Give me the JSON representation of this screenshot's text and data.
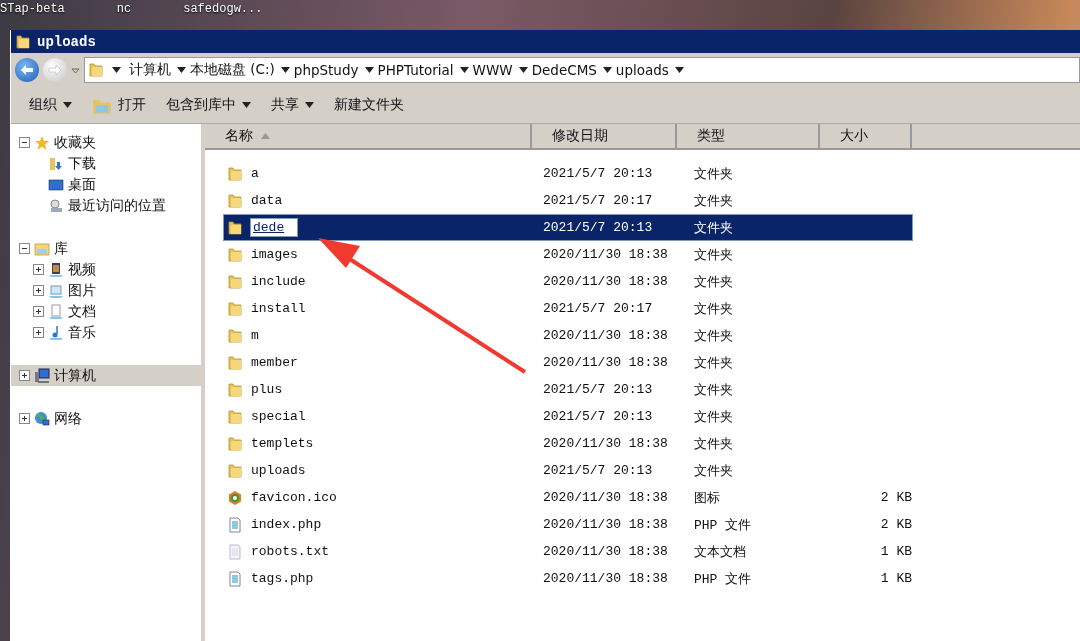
{
  "desktop_icons": [
    "STap-beta",
    "nc",
    "safedogw..."
  ],
  "window": {
    "title": "uploads"
  },
  "address_bar": {
    "crumbs": [
      "计算机",
      "本地磁盘 (C:)",
      "phpStudy",
      "PHPTutorial",
      "WWW",
      "DedeCMS",
      "uploads"
    ]
  },
  "toolbar": [
    {
      "label": "组织",
      "dropdown": true,
      "kind": "menu"
    },
    {
      "label": "打开",
      "dropdown": false,
      "kind": "open"
    },
    {
      "label": "包含到库中",
      "dropdown": true,
      "kind": "menu"
    },
    {
      "label": "共享",
      "dropdown": true,
      "kind": "menu"
    },
    {
      "label": "新建文件夹",
      "dropdown": false,
      "kind": "menu"
    }
  ],
  "sidebar": {
    "groups": [
      {
        "label": "收藏夹",
        "expanded": true,
        "selected": false,
        "children": [
          {
            "label": "下载",
            "selected": false
          },
          {
            "label": "桌面",
            "selected": false
          },
          {
            "label": "最近访问的位置",
            "selected": false
          }
        ]
      },
      {
        "label": "库",
        "expanded": true,
        "selected": false,
        "children": [
          {
            "label": "视频",
            "selected": false,
            "expanded": false
          },
          {
            "label": "图片",
            "selected": false,
            "expanded": false
          },
          {
            "label": "文档",
            "selected": false,
            "expanded": false
          },
          {
            "label": "音乐",
            "selected": false,
            "expanded": false
          }
        ]
      },
      {
        "label": "计算机",
        "expanded": false,
        "selected": true
      },
      {
        "label": "网络",
        "expanded": false,
        "selected": false
      }
    ]
  },
  "table": {
    "columns": [
      "名称",
      "修改日期",
      "类型",
      "大小"
    ],
    "rows": [
      {
        "kind": "folder",
        "name": "a",
        "date": "2021/5/7 20:13",
        "type": "文件夹",
        "selected": false,
        "renaming": false
      },
      {
        "kind": "folder",
        "name": "data",
        "date": "2021/5/7 20:17",
        "type": "文件夹",
        "selected": false,
        "renaming": false
      },
      {
        "kind": "folder",
        "name": "dede",
        "date": "2021/5/7 20:13",
        "type": "文件夹",
        "selected": true,
        "renaming": true
      },
      {
        "kind": "folder",
        "name": "images",
        "date": "2020/11/30 18:38",
        "type": "文件夹",
        "selected": false,
        "renaming": false
      },
      {
        "kind": "folder",
        "name": "include",
        "date": "2020/11/30 18:38",
        "type": "文件夹",
        "selected": false,
        "renaming": false
      },
      {
        "kind": "folder",
        "name": "install",
        "date": "2021/5/7 20:17",
        "type": "文件夹",
        "selected": false,
        "renaming": false
      },
      {
        "kind": "folder",
        "name": "m",
        "date": "2020/11/30 18:38",
        "type": "文件夹",
        "selected": false,
        "renaming": false
      },
      {
        "kind": "folder",
        "name": "member",
        "date": "2020/11/30 18:38",
        "type": "文件夹",
        "selected": false,
        "renaming": false
      },
      {
        "kind": "folder",
        "name": "plus",
        "date": "2021/5/7 20:13",
        "type": "文件夹",
        "selected": false,
        "renaming": false
      },
      {
        "kind": "folder",
        "name": "special",
        "date": "2021/5/7 20:13",
        "type": "文件夹",
        "selected": false,
        "renaming": false
      },
      {
        "kind": "folder",
        "name": "templets",
        "date": "2020/11/30 18:38",
        "type": "文件夹",
        "selected": false,
        "renaming": false
      },
      {
        "kind": "folder",
        "name": "uploads",
        "date": "2021/5/7 20:13",
        "type": "文件夹",
        "selected": false,
        "renaming": false
      },
      {
        "kind": "icon",
        "name": "favicon.ico",
        "date": "2020/11/30 18:38",
        "type": "图标",
        "size": "2 KB",
        "selected": false,
        "renaming": false
      },
      {
        "kind": "php",
        "name": "index.php",
        "date": "2020/11/30 18:38",
        "type": "PHP 文件",
        "size": "2 KB",
        "selected": false,
        "renaming": false
      },
      {
        "kind": "text",
        "name": "robots.txt",
        "date": "2020/11/30 18:38",
        "type": "文本文档",
        "size": "1 KB",
        "selected": false,
        "renaming": false
      },
      {
        "kind": "php",
        "name": "tags.php",
        "date": "2020/11/30 18:38",
        "type": "PHP 文件",
        "size": "1 KB",
        "selected": false,
        "renaming": false
      }
    ]
  }
}
